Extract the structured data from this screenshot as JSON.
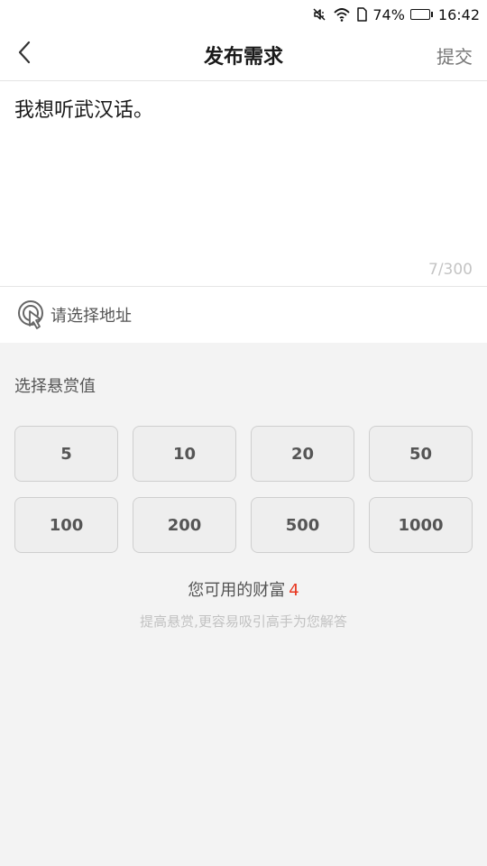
{
  "status_bar": {
    "battery_percent": "74%",
    "battery_level": 0.74,
    "time": "16:42",
    "icons": [
      "mute-icon",
      "wifi-icon",
      "sim-icon",
      "battery-icon"
    ],
    "battery_color": "#34c21b"
  },
  "header": {
    "title": "发布需求",
    "submit_label": "提交",
    "back_icon": "chevron-left-icon"
  },
  "editor": {
    "text": "我想听武汉话。",
    "char_count": "7/300"
  },
  "address": {
    "label": "请选择地址",
    "icon": "location-pointer-icon"
  },
  "reward": {
    "title": "选择悬赏值",
    "options": [
      "5",
      "10",
      "20",
      "50",
      "100",
      "200",
      "500",
      "1000"
    ]
  },
  "wealth": {
    "label": "您可用的财富",
    "value": "4",
    "value_color": "#e8361f"
  },
  "hint": "提高悬赏,更容易吸引高手为您解答"
}
